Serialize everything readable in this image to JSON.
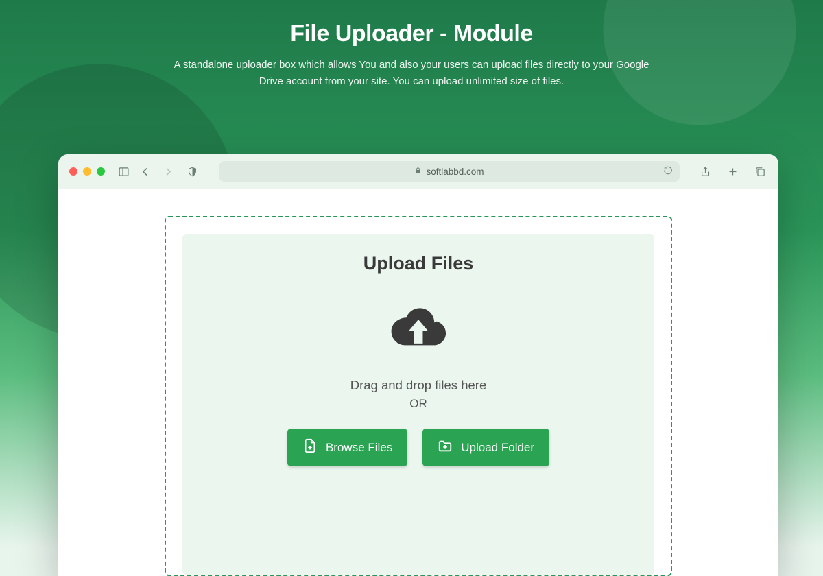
{
  "hero": {
    "title": "File Uploader - Module",
    "subtitle": "A standalone uploader box which allows You and also your users can upload files directly to your Google Drive account from your site. You can upload unlimited size of files."
  },
  "browser": {
    "address": "softlabbd.com"
  },
  "uploader": {
    "heading": "Upload Files",
    "dnd_text": "Drag and drop files here",
    "or_text": "OR",
    "browse_label": "Browse Files",
    "folder_label": "Upload Folder"
  },
  "colors": {
    "accent": "#2aa352",
    "border": "#2a9558"
  }
}
